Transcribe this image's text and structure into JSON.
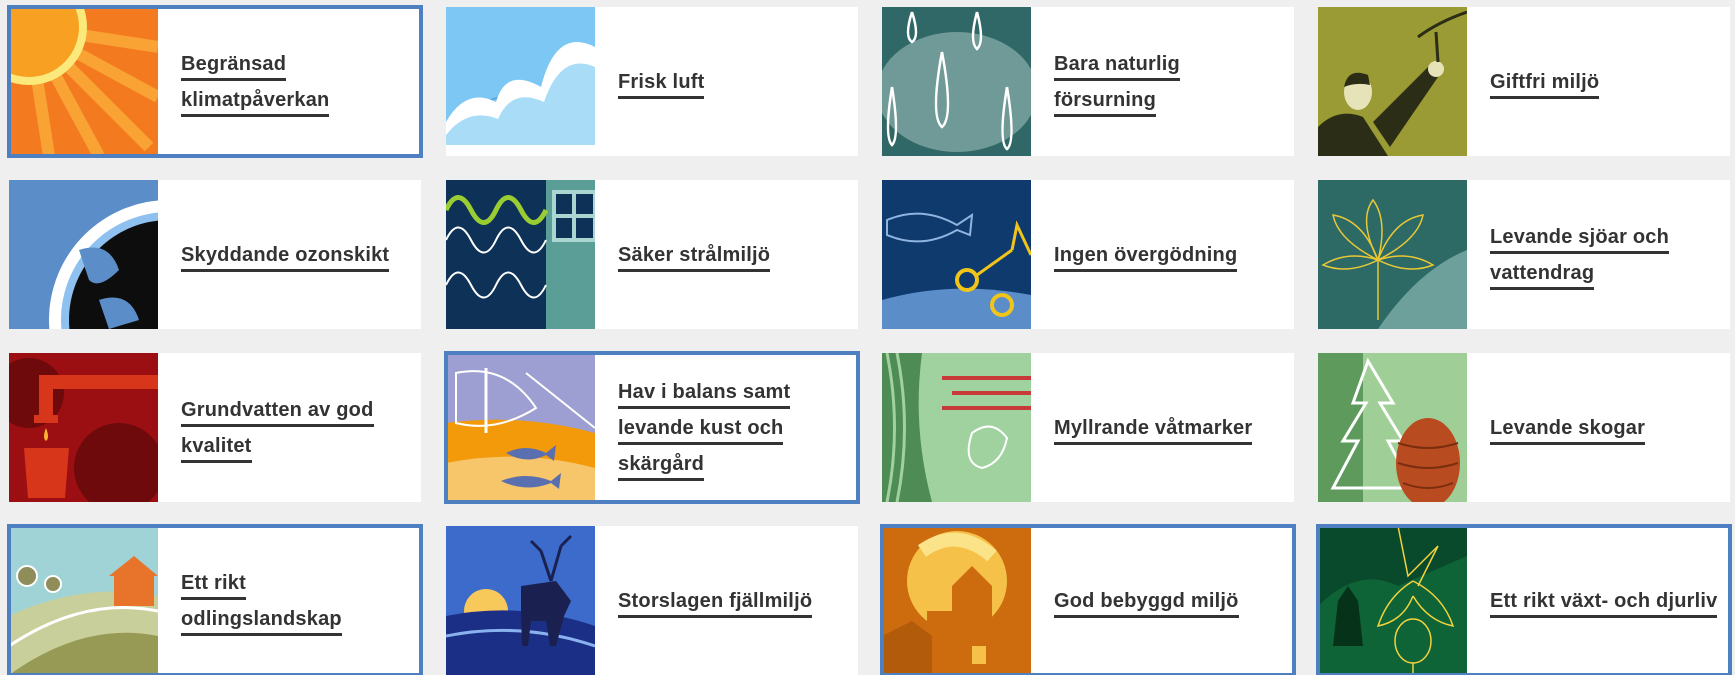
{
  "accent_color": "#4e7fc0",
  "cards": [
    {
      "label": "Begränsad klimatpåverkan",
      "icon": "sun-icon",
      "selected": true
    },
    {
      "label": "Frisk luft",
      "icon": "cloud-icon",
      "selected": false
    },
    {
      "label": "Bara naturlig försurning",
      "icon": "raindrops-icon",
      "selected": false
    },
    {
      "label": "Giftfri miljö",
      "icon": "person-branch-icon",
      "selected": false
    },
    {
      "label": "Skyddande ozonskikt",
      "icon": "globe-icon",
      "selected": false
    },
    {
      "label": "Säker strålmiljö",
      "icon": "radiation-waves-icon",
      "selected": false
    },
    {
      "label": "Ingen övergödning",
      "icon": "fish-icon",
      "selected": false
    },
    {
      "label": "Levande sjöar och vattendrag",
      "icon": "water-lily-icon",
      "selected": false
    },
    {
      "label": "Grundvatten av god kvalitet",
      "icon": "water-tap-icon",
      "selected": false
    },
    {
      "label": "Hav i balans samt levande kust och skärgård",
      "icon": "boat-fish-icon",
      "selected": true
    },
    {
      "label": "Myllrande våtmarker",
      "icon": "frog-icon",
      "selected": false
    },
    {
      "label": "Levande skogar",
      "icon": "tree-pinecone-icon",
      "selected": false
    },
    {
      "label": "Ett rikt odlingslandskap",
      "icon": "farmland-icon",
      "selected": true
    },
    {
      "label": "Storslagen fjällmiljö",
      "icon": "reindeer-icon",
      "selected": false
    },
    {
      "label": "God bebyggd miljö",
      "icon": "house-icon",
      "selected": true
    },
    {
      "label": "Ett rikt växt- och djurliv",
      "icon": "lynx-orchid-icon",
      "selected": true
    }
  ]
}
